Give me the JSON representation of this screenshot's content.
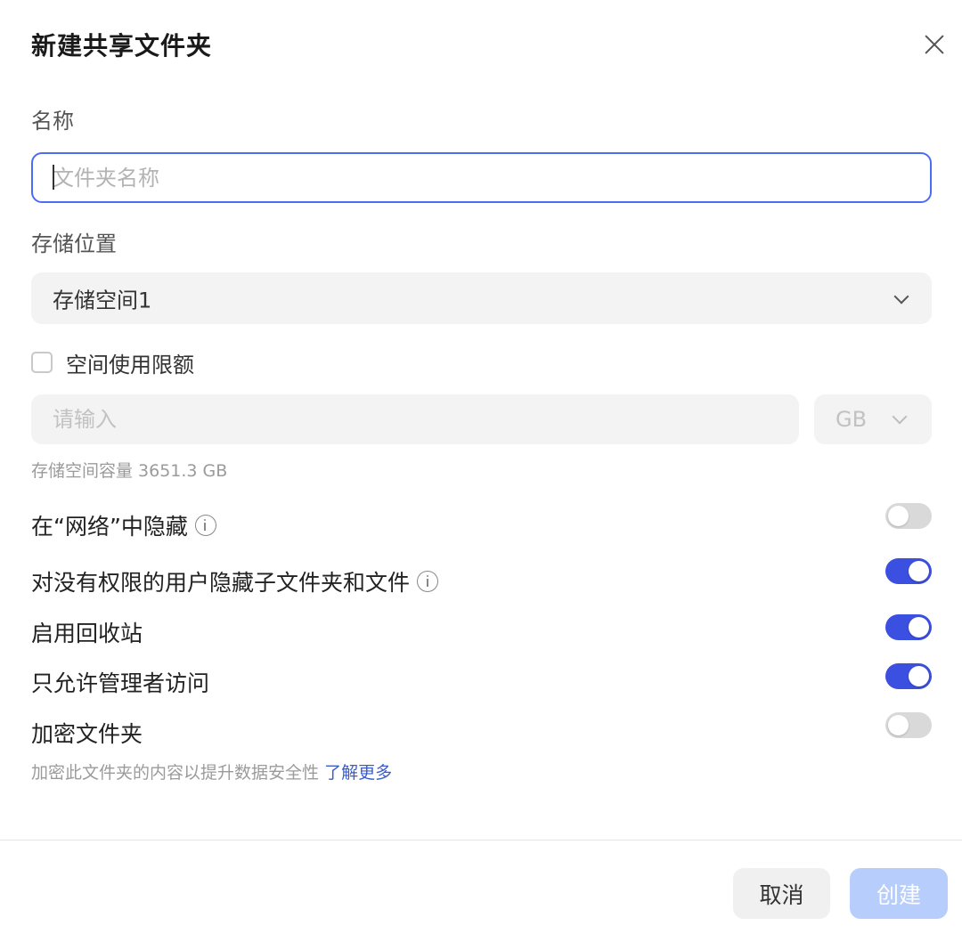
{
  "dialog": {
    "title": "新建共享文件夹"
  },
  "name": {
    "label": "名称",
    "placeholder": "文件夹名称",
    "value": ""
  },
  "storage": {
    "label": "存储位置",
    "selected": "存储空间1"
  },
  "quota": {
    "checkbox_label": "空间使用限额",
    "checked": false,
    "input_placeholder": "请输入",
    "unit": "GB",
    "capacity_hint": "存储空间容量 3651.3 GB"
  },
  "options": [
    {
      "label": "在“网络”中隐藏",
      "info": true,
      "enabled": false
    },
    {
      "label": "对没有权限的用户隐藏子文件夹和文件",
      "info": true,
      "enabled": true
    },
    {
      "label": "启用回收站",
      "info": false,
      "enabled": true
    },
    {
      "label": "只允许管理者访问",
      "info": false,
      "enabled": true
    },
    {
      "label": "加密文件夹",
      "info": false,
      "enabled": false
    }
  ],
  "encrypt_hint": {
    "text": "加密此文件夹的内容以提升数据安全性",
    "link": "了解更多"
  },
  "footer": {
    "cancel_label": "取消",
    "create_label": "创建"
  },
  "colors": {
    "accent": "#3b4fe0",
    "input_border": "#4a6cf7",
    "link": "#3a5ccc",
    "create_disabled": "#b7cdfb"
  }
}
